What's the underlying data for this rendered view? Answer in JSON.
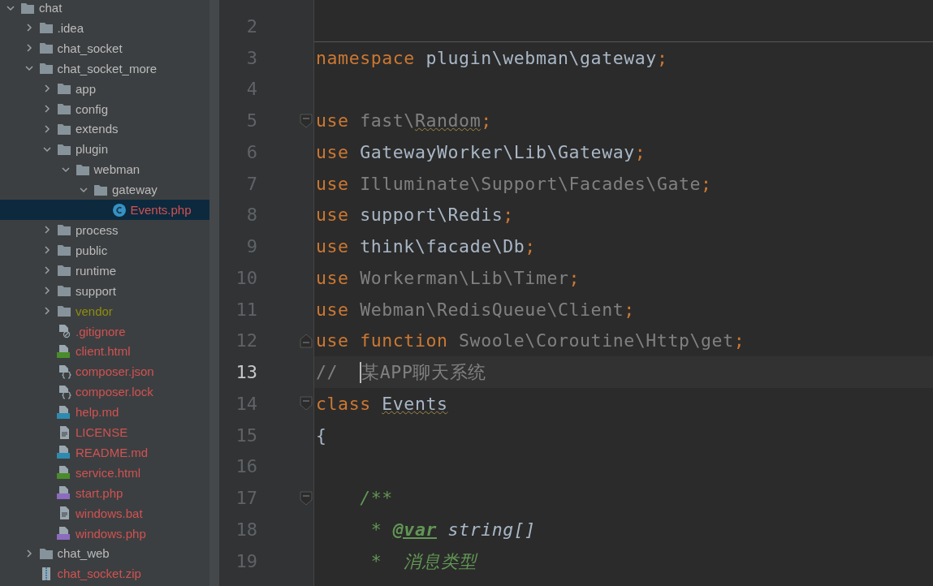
{
  "project_tree": [
    {
      "label": "chat",
      "kind": "folder",
      "expanded": true,
      "selected": false,
      "children": [
        {
          "label": ".idea",
          "kind": "folder",
          "expanded": false,
          "selected": false
        },
        {
          "label": "chat_socket",
          "kind": "folder",
          "expanded": false,
          "selected": false
        },
        {
          "label": "chat_socket_more",
          "kind": "folder",
          "expanded": true,
          "selected": false,
          "children": [
            {
              "label": "app",
              "kind": "folder",
              "expanded": false,
              "selected": false
            },
            {
              "label": "config",
              "kind": "folder",
              "expanded": false,
              "selected": false
            },
            {
              "label": "extends",
              "kind": "folder",
              "expanded": false,
              "selected": false
            },
            {
              "label": "plugin",
              "kind": "folder",
              "expanded": true,
              "selected": false,
              "children": [
                {
                  "label": "webman",
                  "kind": "folder",
                  "expanded": true,
                  "selected": false,
                  "children": [
                    {
                      "label": "gateway",
                      "kind": "folder",
                      "expanded": true,
                      "selected": false,
                      "children": [
                        {
                          "label": "Events.php",
                          "kind": "php-class",
                          "selected": true,
                          "color": "#d25252"
                        }
                      ]
                    }
                  ]
                }
              ]
            },
            {
              "label": "process",
              "kind": "folder",
              "expanded": false,
              "selected": false
            },
            {
              "label": "public",
              "kind": "folder",
              "expanded": false,
              "selected": false
            },
            {
              "label": "runtime",
              "kind": "folder",
              "expanded": false,
              "selected": false
            },
            {
              "label": "support",
              "kind": "folder",
              "expanded": false,
              "selected": false
            },
            {
              "label": "vendor",
              "kind": "folder",
              "expanded": false,
              "selected": false,
              "color": "#8e8e0a"
            },
            {
              "label": ".gitignore",
              "kind": "ignore",
              "selected": false,
              "color": "#d25252"
            },
            {
              "label": "client.html",
              "kind": "html",
              "selected": false,
              "color": "#d25252"
            },
            {
              "label": "composer.json",
              "kind": "json",
              "selected": false,
              "color": "#d25252"
            },
            {
              "label": "composer.lock",
              "kind": "json",
              "selected": false,
              "color": "#d25252"
            },
            {
              "label": "help.md",
              "kind": "md",
              "selected": false,
              "color": "#d25252"
            },
            {
              "label": "LICENSE",
              "kind": "text",
              "selected": false,
              "color": "#d25252"
            },
            {
              "label": "README.md",
              "kind": "md",
              "selected": false,
              "color": "#d25252"
            },
            {
              "label": "service.html",
              "kind": "html",
              "selected": false,
              "color": "#d25252"
            },
            {
              "label": "start.php",
              "kind": "php",
              "selected": false,
              "color": "#d25252"
            },
            {
              "label": "windows.bat",
              "kind": "text",
              "selected": false,
              "color": "#d25252"
            },
            {
              "label": "windows.php",
              "kind": "php",
              "selected": false,
              "color": "#d25252"
            }
          ]
        },
        {
          "label": "chat_web",
          "kind": "folder",
          "expanded": false,
          "selected": false
        },
        {
          "label": "chat_socket.zip",
          "kind": "zip",
          "selected": false,
          "color": "#d25252"
        }
      ]
    }
  ],
  "editor": {
    "lines": [
      {
        "number": "2",
        "current": false
      },
      {
        "number": "3",
        "current": false,
        "tokens": [
          {
            "kind": "keyword",
            "text": "namespace "
          },
          {
            "kind": "plain",
            "text": "plugin\\webman\\gateway"
          },
          {
            "kind": "keyword",
            "text": ";"
          }
        ]
      },
      {
        "number": "4",
        "current": false
      },
      {
        "number": "5",
        "current": false,
        "fold_start": true,
        "tokens": [
          {
            "kind": "keyword",
            "text": "use "
          },
          {
            "kind": "unused",
            "text": "fast\\"
          },
          {
            "kind": "unused",
            "text": "Random",
            "warning": true
          },
          {
            "kind": "keyword",
            "text": ";"
          }
        ]
      },
      {
        "number": "6",
        "current": false,
        "tokens": [
          {
            "kind": "keyword",
            "text": "use "
          },
          {
            "kind": "plain",
            "text": "GatewayWorker\\Lib\\Gateway"
          },
          {
            "kind": "keyword",
            "text": ";"
          }
        ]
      },
      {
        "number": "7",
        "current": false,
        "tokens": [
          {
            "kind": "keyword",
            "text": "use "
          },
          {
            "kind": "unused",
            "text": "Illuminate\\Support\\Facades\\Gate"
          },
          {
            "kind": "keyword",
            "text": ";"
          }
        ]
      },
      {
        "number": "8",
        "current": false,
        "tokens": [
          {
            "kind": "keyword",
            "text": "use "
          },
          {
            "kind": "plain",
            "text": "support\\Redis"
          },
          {
            "kind": "keyword",
            "text": ";"
          }
        ]
      },
      {
        "number": "9",
        "current": false,
        "tokens": [
          {
            "kind": "keyword",
            "text": "use "
          },
          {
            "kind": "plain",
            "text": "think\\facade\\Db"
          },
          {
            "kind": "keyword",
            "text": ";"
          }
        ]
      },
      {
        "number": "10",
        "current": false,
        "tokens": [
          {
            "kind": "keyword",
            "text": "use "
          },
          {
            "kind": "unused",
            "text": "Workerman\\Lib\\Timer"
          },
          {
            "kind": "keyword",
            "text": ";"
          }
        ]
      },
      {
        "number": "11",
        "current": false,
        "tokens": [
          {
            "kind": "keyword",
            "text": "use "
          },
          {
            "kind": "unused",
            "text": "Webman\\RedisQueue\\Client"
          },
          {
            "kind": "keyword",
            "text": ";"
          }
        ]
      },
      {
        "number": "12",
        "current": false,
        "fold_end": true,
        "tokens": [
          {
            "kind": "keyword",
            "text": "use function "
          },
          {
            "kind": "unused",
            "text": "Swoole\\Coroutine\\Http\\get"
          },
          {
            "kind": "keyword",
            "text": ";"
          }
        ]
      },
      {
        "number": "13",
        "current": true,
        "tokens": [
          {
            "kind": "comment",
            "text": "//  "
          },
          {
            "kind": "comment",
            "text": "某APP聊天系统",
            "caret_before": true
          }
        ]
      },
      {
        "number": "14",
        "current": false,
        "fold_start": true,
        "tokens": [
          {
            "kind": "keyword",
            "text": "class "
          },
          {
            "kind": "plain",
            "text": "Events",
            "warning": true
          }
        ]
      },
      {
        "number": "15",
        "current": false,
        "tokens": [
          {
            "kind": "plain",
            "text": "{"
          }
        ]
      },
      {
        "number": "16",
        "current": false
      },
      {
        "number": "17",
        "current": false,
        "fold_start": true,
        "tokens": [
          {
            "kind": "doc",
            "text": "    /**"
          }
        ]
      },
      {
        "number": "18",
        "current": false,
        "tokens": [
          {
            "kind": "doc",
            "text": "     * "
          },
          {
            "kind": "doctag",
            "text": "@var"
          },
          {
            "kind": "doctype",
            "text": " string[]"
          }
        ]
      },
      {
        "number": "19",
        "current": false,
        "tokens": [
          {
            "kind": "doc",
            "text": "     *  消息类型"
          }
        ]
      }
    ]
  }
}
